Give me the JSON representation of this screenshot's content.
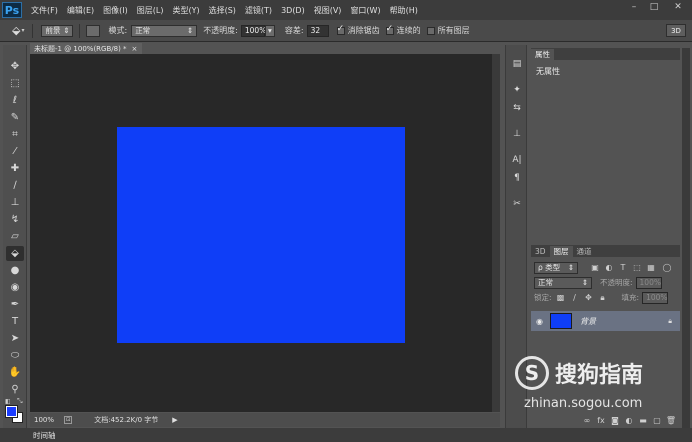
{
  "app": {
    "logo": "Ps",
    "menu": [
      "文件(F)",
      "编辑(E)",
      "图像(I)",
      "图层(L)",
      "类型(Y)",
      "选择(S)",
      "滤镜(T)",
      "3D(D)",
      "视图(V)",
      "窗口(W)",
      "帮助(H)"
    ]
  },
  "options": {
    "fill_source": "前景",
    "mode_label": "模式:",
    "mode_value": "正常",
    "opacity_label": "不透明度:",
    "opacity_value": "100%",
    "tolerance_label": "容差:",
    "tolerance_value": "32",
    "antialias_label": "消除锯齿",
    "contiguous_label": "连续的",
    "all_layers_label": "所有图层",
    "btn_3d": "3D"
  },
  "document": {
    "tab_label": "未标题-1 @ 100%(RGB/8) *",
    "canvas_color": "#0f3ef7",
    "zoom": "100%",
    "doc_info": "文档:452.2K/0 字节"
  },
  "timeline": {
    "label": "时间轴"
  },
  "properties": {
    "tab_label": "属性",
    "content": "无属性"
  },
  "layers": {
    "tabs": [
      "3D",
      "图层",
      "通道"
    ],
    "filter_label": "ρ 类型",
    "blend_mode": "正常",
    "opacity_label": "不透明度:",
    "opacity_value": "100%",
    "lock_label": "锁定:",
    "fill_label": "填充:",
    "fill_value": "100%",
    "layer_name": "背景",
    "layer_color": "#0f3ef7"
  },
  "watermark": {
    "brand": "搜狗指南",
    "url": "zhinan.sogou.com"
  },
  "colors": {
    "foreground": "#1a3cff",
    "background": "#ffffff"
  }
}
